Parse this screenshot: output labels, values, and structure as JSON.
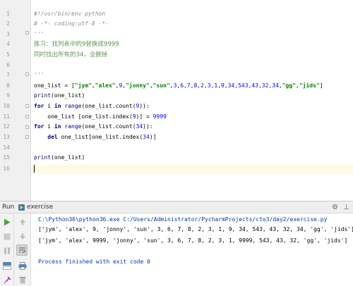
{
  "editor": {
    "line_numbers": [
      "1",
      "2",
      "3",
      "4",
      "5",
      "6",
      "7",
      "8",
      "9",
      "10",
      "11",
      "12",
      "13",
      "14",
      "15",
      "16"
    ],
    "lines": [
      {
        "segments": [
          {
            "t": "#!/usr/bin/env python",
            "c": "c-comment"
          }
        ]
      },
      {
        "segments": [
          {
            "t": "# -*- coding:utf-8 -*-",
            "c": "c-comment"
          }
        ]
      },
      {
        "segments": [
          {
            "t": "'''",
            "c": "c-doc"
          }
        ]
      },
      {
        "segments": [
          {
            "t": "练习：找列表中的9替换成9999",
            "c": "c-cjk"
          }
        ]
      },
      {
        "segments": [
          {
            "t": "同时找出所有的34，全删掉",
            "c": "c-cjk"
          }
        ]
      },
      {
        "segments": []
      },
      {
        "segments": [
          {
            "t": "'''",
            "c": "c-doc"
          }
        ]
      },
      {
        "segments": [
          {
            "t": "one_list = [",
            "c": ""
          },
          {
            "t": "\"jym\"",
            "c": "c-str"
          },
          {
            "t": ",",
            "c": ""
          },
          {
            "t": "\"alex\"",
            "c": "c-str"
          },
          {
            "t": ",",
            "c": ""
          },
          {
            "t": "9",
            "c": "c-num"
          },
          {
            "t": ",",
            "c": ""
          },
          {
            "t": "\"jonny\"",
            "c": "c-str"
          },
          {
            "t": ",",
            "c": ""
          },
          {
            "t": "\"sun\"",
            "c": "c-str"
          },
          {
            "t": ",",
            "c": ""
          },
          {
            "t": "3,6,7,8,2,3,1,9,34,543,43,32,34",
            "c": "c-num"
          },
          {
            "t": ",",
            "c": ""
          },
          {
            "t": "\"gg\"",
            "c": "c-str"
          },
          {
            "t": ",",
            "c": ""
          },
          {
            "t": "\"jids\"",
            "c": "c-str"
          },
          {
            "t": "]",
            "c": ""
          }
        ]
      },
      {
        "segments": [
          {
            "t": "print",
            "c": "c-fn"
          },
          {
            "t": "(one_list)",
            "c": ""
          }
        ]
      },
      {
        "segments": [
          {
            "t": "for",
            "c": "c-kw"
          },
          {
            "t": " i ",
            "c": ""
          },
          {
            "t": "in",
            "c": "c-kw"
          },
          {
            "t": " ",
            "c": ""
          },
          {
            "t": "range",
            "c": "c-fn"
          },
          {
            "t": "(one_list.count(",
            "c": ""
          },
          {
            "t": "9",
            "c": "c-num"
          },
          {
            "t": ")):",
            "c": ""
          }
        ]
      },
      {
        "segments": [
          {
            "t": "    one_list [one_list.index(",
            "c": ""
          },
          {
            "t": "9",
            "c": "c-num"
          },
          {
            "t": ")] = ",
            "c": ""
          },
          {
            "t": "9999",
            "c": "c-num"
          }
        ]
      },
      {
        "segments": [
          {
            "t": "for",
            "c": "c-kw"
          },
          {
            "t": " i ",
            "c": ""
          },
          {
            "t": "in",
            "c": "c-kw"
          },
          {
            "t": " ",
            "c": ""
          },
          {
            "t": "range",
            "c": "c-fn"
          },
          {
            "t": "(one_list.count(",
            "c": ""
          },
          {
            "t": "34",
            "c": "c-num"
          },
          {
            "t": ")):",
            "c": ""
          }
        ]
      },
      {
        "segments": [
          {
            "t": "    ",
            "c": ""
          },
          {
            "t": "del",
            "c": "c-kw"
          },
          {
            "t": " one_list[one_list.index(",
            "c": ""
          },
          {
            "t": "34",
            "c": "c-num"
          },
          {
            "t": ")]",
            "c": ""
          }
        ]
      },
      {
        "segments": []
      },
      {
        "segments": [
          {
            "t": "print",
            "c": "c-fn"
          },
          {
            "t": "(one_list)",
            "c": ""
          }
        ]
      },
      {
        "segments": []
      }
    ]
  },
  "run_window": {
    "label": "Run",
    "config_name": "exercise",
    "output": {
      "command": "C:\\Python36\\python36.exe C:/Users/Administrator/PycharmProjects/cto3/day2/exercise.py",
      "line1": "['jym', 'alex', 9, 'jonny', 'sun', 3, 6, 7, 8, 2, 3, 1, 9, 34, 543, 43, 32, 34, 'gg', 'jids']",
      "line2": "['jym', 'alex', 9999, 'jonny', 'sun', 3, 6, 7, 8, 2, 3, 1, 9999, 543, 43, 32, 'gg', 'jids']",
      "exit": "Process finished with exit code 0"
    }
  },
  "icons": {
    "run_tab": "python-run-icon",
    "settings": "gear-icon",
    "hide": "hide-panel-icon",
    "rerun": "play-icon",
    "stop": "stop-icon",
    "pause": "pause-icon",
    "up": "up-arrow-icon",
    "down": "down-arrow-icon",
    "soft_wrap": "soft-wrap-icon",
    "print": "print-icon"
  },
  "colors": {
    "keyword": "#000080",
    "string": "#008000",
    "number": "#0000ff",
    "comment": "#8c8c8c",
    "docstring": "#629755",
    "caret_line": "#fffae3",
    "command_text": "#0033b3"
  }
}
